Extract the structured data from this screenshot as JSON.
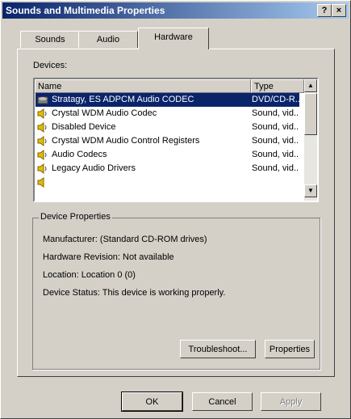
{
  "window": {
    "title": "Sounds and Multimedia Properties",
    "help_label": "?",
    "close_label": "×"
  },
  "tabs": [
    {
      "label": "Sounds"
    },
    {
      "label": "Audio"
    },
    {
      "label": "Hardware"
    }
  ],
  "devices": {
    "label": "Devices:",
    "columns": {
      "name": "Name",
      "type": "Type"
    },
    "rows": [
      {
        "name": "Stratagy, ES ADPCM Audio CODEC",
        "type": "DVD/CD-R...",
        "icon": "cdrom-icon",
        "selected": true
      },
      {
        "name": "Crystal WDM Audio Codec",
        "type": "Sound, vid...",
        "icon": "speaker-icon"
      },
      {
        "name": "Disabled Device",
        "type": "Sound, vid...",
        "icon": "speaker-icon"
      },
      {
        "name": "Crystal WDM Audio Control Registers",
        "type": "Sound, vid...",
        "icon": "speaker-icon"
      },
      {
        "name": "Audio Codecs",
        "type": "Sound, vid...",
        "icon": "speaker-icon"
      },
      {
        "name": "Legacy Audio Drivers",
        "type": "Sound, vid...",
        "icon": "speaker-icon"
      }
    ]
  },
  "properties": {
    "title": "Device Properties",
    "manufacturer": "Manufacturer: (Standard CD-ROM drives)",
    "revision": "Hardware Revision: Not available",
    "location": "Location: Location 0 (0)",
    "status": "Device Status: This device is working properly."
  },
  "buttons": {
    "troubleshoot": "Troubleshoot...",
    "properties": "Properties",
    "ok": "OK",
    "cancel": "Cancel",
    "apply": "Apply"
  }
}
